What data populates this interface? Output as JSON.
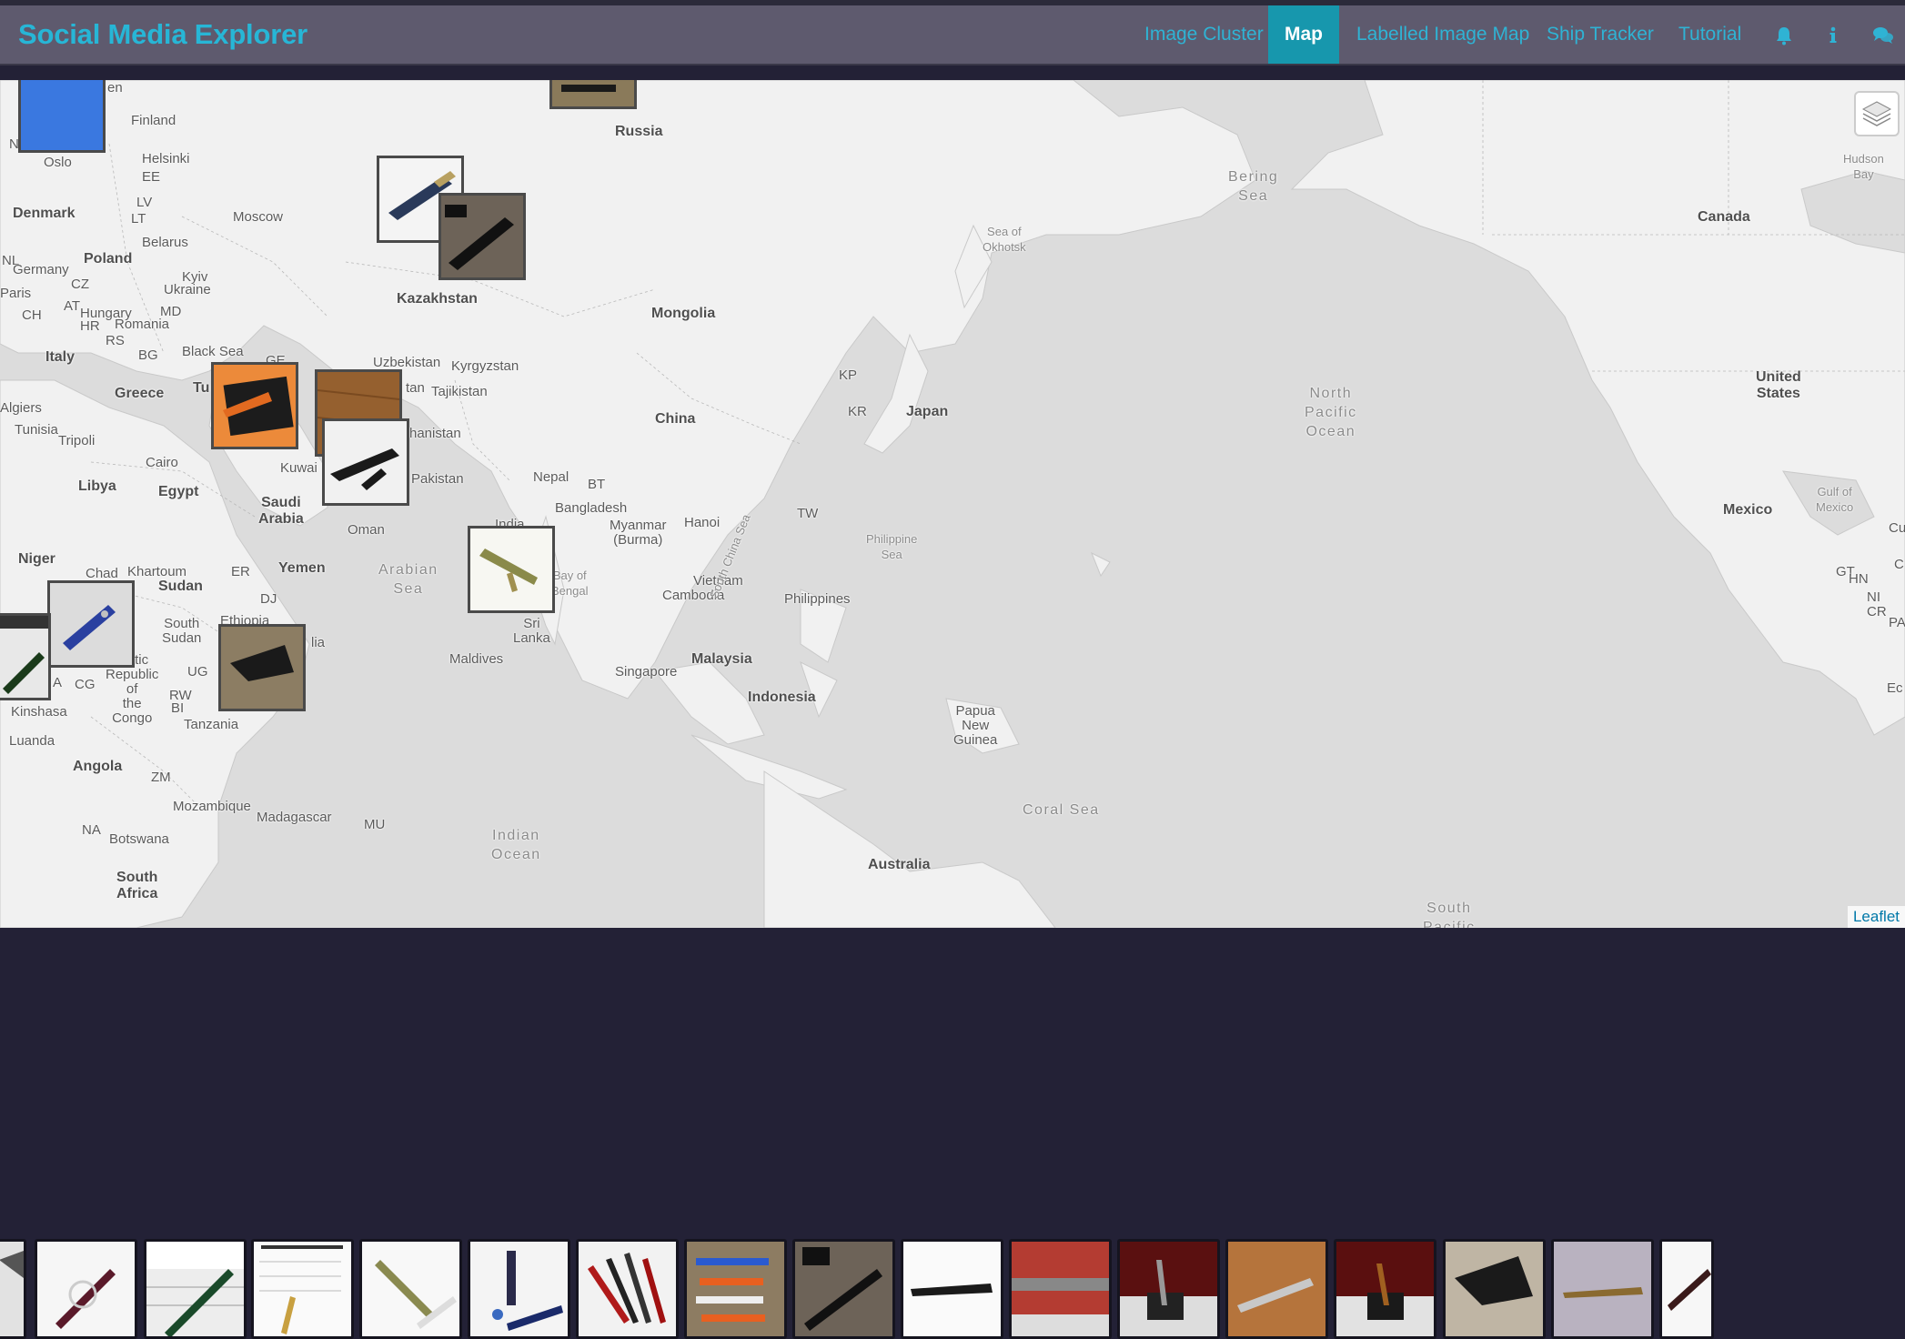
{
  "app": {
    "brand": "Social Media Explorer",
    "nav": [
      {
        "label": "Image Cluster",
        "active": false
      },
      {
        "label": "Map",
        "active": true
      },
      {
        "label": "Labelled Image Map",
        "active": false
      },
      {
        "label": "Ship Tracker",
        "active": false
      },
      {
        "label": "Tutorial",
        "active": false
      }
    ],
    "nav_icons": [
      "bell-icon",
      "info-icon",
      "comments-icon"
    ]
  },
  "map": {
    "attribution": "Leaflet",
    "layers_control_icon": "layers-icon",
    "labels": {
      "finland": "Finland",
      "norway": "Norway",
      "oslo": "Oslo",
      "helsinki": "Helsinki",
      "ee": "EE",
      "lv": "LV",
      "lt": "LT",
      "denmark": "Denmark",
      "moscow": "Moscow",
      "belarus": "Belarus",
      "nl": "NL",
      "germany": "Germany",
      "poland": "Poland",
      "paris": "Paris",
      "cz": "CZ",
      "kyiv": "Kyiv",
      "ukraine": "Ukraine",
      "ch": "CH",
      "at": "AT",
      "hungary": "Hungary",
      "md": "MD",
      "hr": "HR",
      "romania": "Romania",
      "rs": "RS",
      "bg": "BG",
      "italy": "Italy",
      "black_sea": "Black Sea",
      "ge": "GE",
      "greece": "Greece",
      "tu": "Tu",
      "algiers": "Algiers",
      "tunisia": "Tunisia",
      "tripoli": "Tripoli",
      "cairo": "Cairo",
      "libya": "Libya",
      "egypt": "Egypt",
      "kuwait": "Kuwai",
      "saudi": "Saudi\nArabia",
      "oman": "Oman",
      "yemen": "Yemen",
      "niger": "Niger",
      "chad": "Chad",
      "khartoum": "Khartoum",
      "er": "ER",
      "sudan": "Sudan",
      "dj": "DJ",
      "ethiopia": "Ethiopia",
      "south_sudan": "South\nSudan",
      "cratic": "cratic\nRepublic\nof\nthe\nCongo",
      "a": "A",
      "cg": "CG",
      "ug": "UG",
      "kinshasa": "Kinshasa",
      "rw": "RW",
      "bi": "BI",
      "tanzania": "Tanzania",
      "luanda": "Luanda",
      "angola": "Angola",
      "zm": "ZM",
      "mozambique": "Mozambique",
      "madagascar": "Madagascar",
      "mu": "MU",
      "na": "NA",
      "botswana": "Botswana",
      "south_africa": "South\nAfrica",
      "lia": "lia",
      "russia": "Russia",
      "kazakhstan": "Kazakhstan",
      "uzbekistan": "Uzbekistan",
      "kyrgyzstan": "Kyrgyzstan",
      "tajikistan": "Tajikistan",
      "tan": "tan",
      "afghanistan": "hanistan",
      "pakistan": "Pakistan",
      "mongolia": "Mongolia",
      "china": "China",
      "nepal": "Nepal",
      "bt": "BT",
      "india": "India",
      "bangladesh": "Bangladesh",
      "myanmar": "Myanmar\n(Burma)",
      "hanoi": "Hanoi",
      "vietnam": "Vietnam",
      "cambodia": "Cambodia",
      "sri_lanka": "Sri\nLanka",
      "maldives": "Maldives",
      "malaysia": "Malaysia",
      "singapore": "Singapore",
      "indonesia": "Indonesia",
      "philippines": "Philippines",
      "kp": "KP",
      "kr": "KR",
      "japan": "Japan",
      "tw": "TW",
      "papua": "Papua\nNew\nGuinea",
      "australia": "Australia",
      "canada": "Canada",
      "united_states": "United\nStates",
      "mexico": "Mexico",
      "gt": "GT",
      "hn": "HN",
      "ni": "NI",
      "cr": "CR",
      "cu": "Cu",
      "c": "C",
      "pa": "PA",
      "ec": "Ec",
      "en": "en"
    },
    "sea_labels": {
      "arabian_sea": "Arabian\nSea",
      "bay_of_bengal": "Bay of\nBengal",
      "indian_ocean": "Indian\nOcean",
      "north_pacific": "North\nPacific\nOcean",
      "bering_sea": "Bering\nSea",
      "sea_of_okhotsk": "Sea of\nOkhotsk",
      "philippine_sea": "Philippine\nSea",
      "south_china_sea": "South China Sea",
      "coral_sea": "Coral Sea",
      "hudson_bay": "Hudson\nBay",
      "gulf_of_mexico": "Gulf of\nMexico",
      "south_pacific": "South\nPacific"
    }
  },
  "thumbnails_count": 17
}
